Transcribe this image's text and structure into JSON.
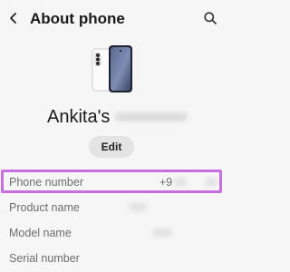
{
  "header": {
    "title": "About phone",
    "back_icon": "chevron-left-icon",
    "search_icon": "search-icon"
  },
  "device": {
    "image_icon": "phone-device-icon",
    "name_visible": "Ankita's"
  },
  "edit_label": "Edit",
  "info_rows": [
    {
      "label": "Phone number",
      "value": "+9"
    },
    {
      "label": "Product name",
      "value": ""
    },
    {
      "label": "Model name",
      "value": ""
    },
    {
      "label": "Serial number",
      "value": ""
    }
  ],
  "colors": {
    "background": "#f6f6f6",
    "highlight": "#c86fe0",
    "edit_button_bg": "#e4e4e4",
    "label_text": "#6d6d6d"
  }
}
